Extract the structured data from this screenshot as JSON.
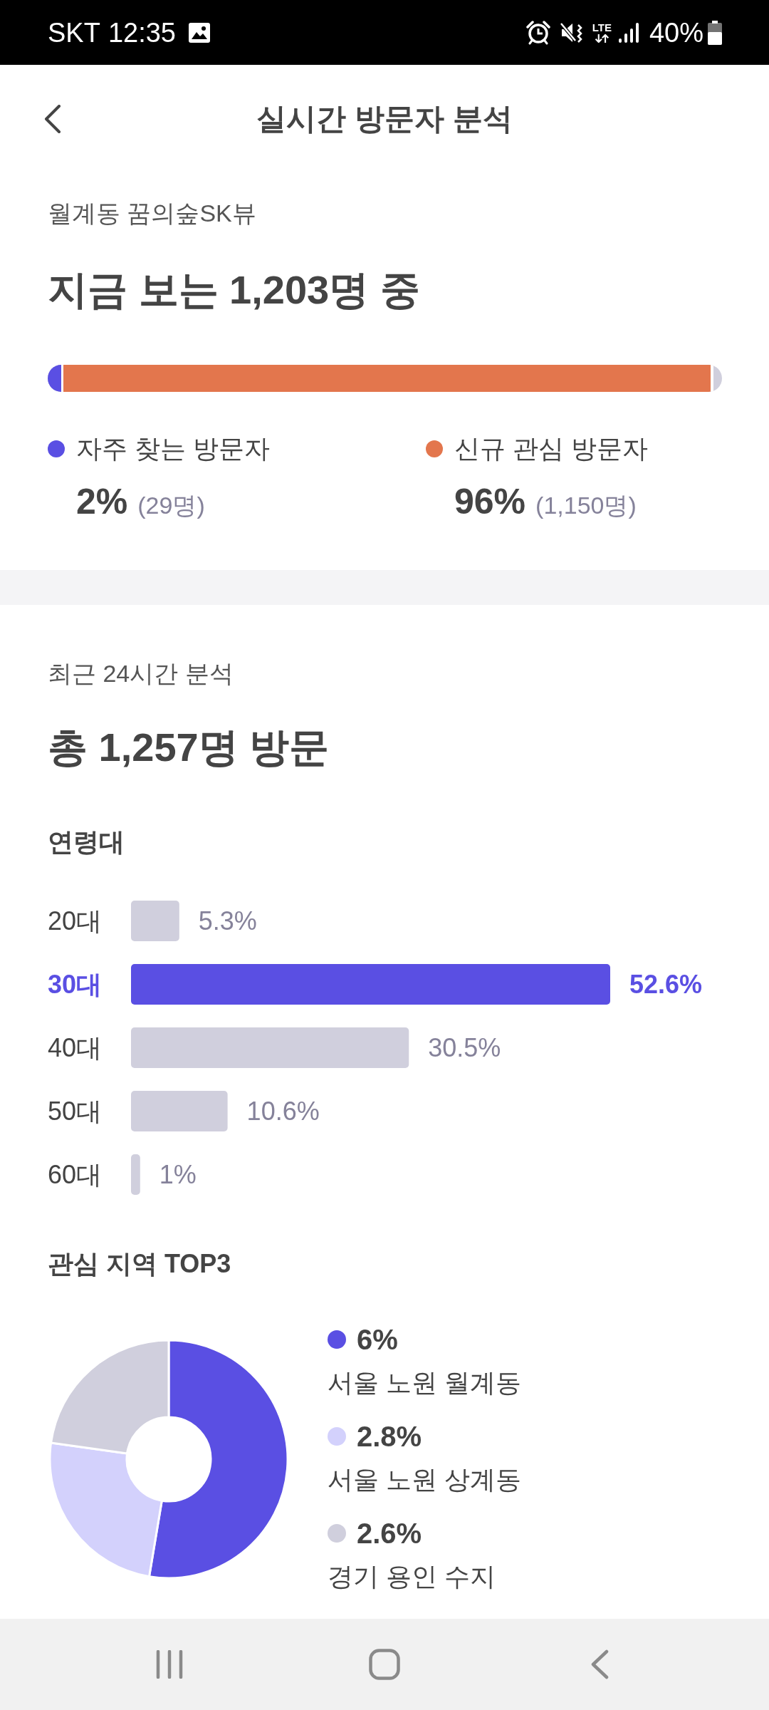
{
  "status_bar": {
    "carrier": "SKT",
    "time": "12:35",
    "network": "LTE",
    "battery": "40%"
  },
  "header": {
    "title": "실시간 방문자 분석"
  },
  "live": {
    "place": "월계동 꿈의숲SK뷰",
    "headline": "지금 보는 1,203명 중",
    "groups": [
      {
        "label": "자주 찾는 방문자",
        "color": "#5a4fe3",
        "level": 0.02,
        "percent": "2%",
        "count": "(29명)"
      },
      {
        "label": "신규 관심 방문자",
        "color": "#e3764d",
        "level": 0.96,
        "percent": "96%",
        "count": "(1,150명)"
      }
    ]
  },
  "last_24h": {
    "period": "최근 24시간 분석",
    "headline": "총 1,257명 방문",
    "age": {
      "title": "연령대",
      "chart_data": {
        "type": "bar",
        "orientation": "horizontal",
        "categories": [
          "20대",
          "30대",
          "40대",
          "50대",
          "60대"
        ],
        "values": [
          5.3,
          52.6,
          30.5,
          10.6,
          1
        ],
        "value_labels": [
          "5.3%",
          "52.6%",
          "30.5%",
          "10.6%",
          "1%"
        ]
      }
    },
    "regions": {
      "title": "관심 지역 TOP3",
      "chart_data": {
        "type": "donut",
        "categories": [
          "서울 노원 월계동",
          "서울 노원 상계동",
          "경기 용인 수지"
        ],
        "values": [
          6,
          2.8,
          2.6
        ],
        "value_labels": [
          "6%",
          "2.8%",
          "2.6%"
        ],
        "legend": "right"
      },
      "slices": [
        {
          "color": "#5a4fe3"
        },
        {
          "color": "#d3d1fc"
        },
        {
          "color": "#d0cfdd"
        }
      ]
    }
  }
}
